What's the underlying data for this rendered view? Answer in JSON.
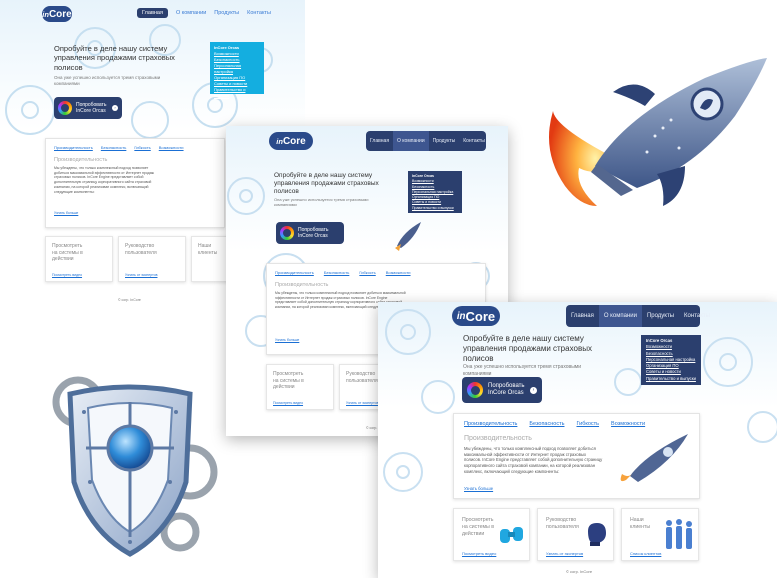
{
  "logo": {
    "prefix": "in",
    "name": "Core"
  },
  "nav": {
    "home": "Главная",
    "about": "О компании",
    "products": "Продукты",
    "contacts": "Контакты"
  },
  "hero": {
    "title": "Опробуйте в деле нашу систему управления продажами страховых полисов",
    "text": "Она уже успешно используется тремя страховыми компаниями"
  },
  "cta": {
    "line1": "Попробовать",
    "line2": "InCore Orcas"
  },
  "menu": {
    "title": "InCore Orcas",
    "items": [
      "Возможности",
      "Безопасность",
      "Персональная настройка",
      "Организация ПО",
      "Советы и новости",
      "Правительство и выпуски"
    ]
  },
  "tabs": [
    "Производительность",
    "Безопасность",
    "Гибкость",
    "Возможности"
  ],
  "panel": {
    "heading": "Производительность",
    "text": "Мы убеждены, что только комплексный подход позволяет добиться максимальной эффективности от Интернет продаж страховых полисов. InCore Engine представляет собой дополнительную страницу корпоративного сайта страховой компании, на которой реализован комплекс, включающий следующие компоненты:",
    "more": "Узнать больше"
  },
  "cards": [
    {
      "title": "Просмотреть на системы в действии",
      "link": "Посмотреть видео"
    },
    {
      "title": "Руководство пользователя",
      "link": "Узнать от экспертов"
    },
    {
      "title": "Наши клиенты",
      "link": "Список клиентов"
    }
  ],
  "footer": "© corp. InCore",
  "colors": {
    "navy": "#2b3f6e",
    "cyan": "#14aee0",
    "link": "#1a6fd4",
    "flame": "#f26a1b"
  },
  "icons": [
    "gear-icon",
    "rocket-icon",
    "shield-icon",
    "binoculars-icon",
    "boxing-glove-icon",
    "people-icon"
  ]
}
